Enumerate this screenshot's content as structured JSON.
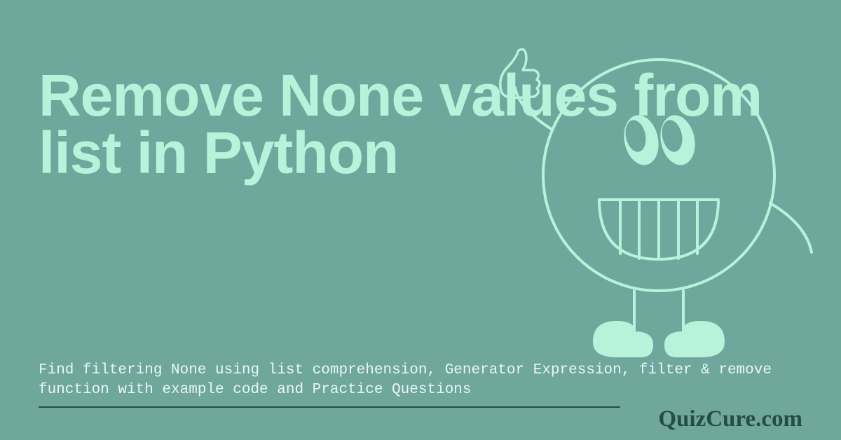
{
  "title": "Remove None values from list in Python",
  "subtitle": "Find filtering None using list comprehension, Generator Expression, filter & remove function with example code and Practice Questions",
  "brand": "QuizCure.com",
  "colors": {
    "background": "#6fa79d",
    "accent": "#b8f2db",
    "stroke": "#264c47",
    "text_light": "#e9f7f2"
  },
  "icon": "thumbs-up-mascot"
}
